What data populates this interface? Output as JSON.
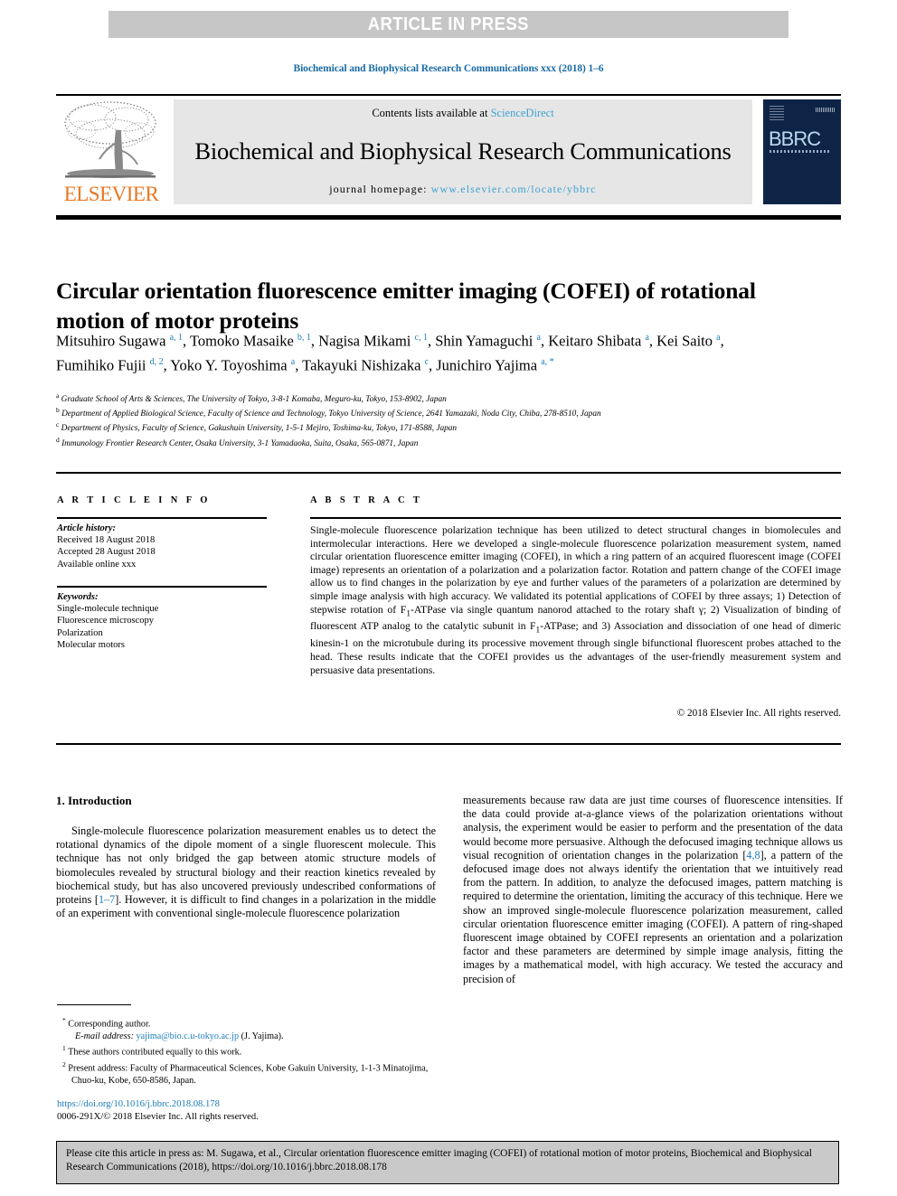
{
  "banner": {
    "text": "ARTICLE IN PRESS"
  },
  "running_head": "Biochemical and Biophysical Research Communications xxx (2018) 1–6",
  "masthead": {
    "contents_prefix": "Contents lists available at ",
    "contents_link": "ScienceDirect",
    "journal_title": "Biochemical and Biophysical Research Communications",
    "homepage_prefix": "journal homepage: ",
    "homepage_url": "www.elsevier.com/locate/ybbrc",
    "publisher_name": "ELSEVIER",
    "cover_title": "BBRC",
    "link_color": "#3fa2d1",
    "brand_color": "#e87722"
  },
  "article": {
    "title": "Circular orientation fluorescence emitter imaging (COFEI) of rotational motion of motor proteins",
    "authors_html": "Mitsuhiro Sugawa <sup>a, 1</sup>, Tomoko Masaike <sup>b, 1</sup>, Nagisa Mikami <sup>c, 1</sup>, Shin Yamaguchi <sup>a</sup>, Keitaro Shibata <sup>a</sup>, Kei Saito <sup>a</sup>, Fumihiko Fujii <sup>d, 2</sup>, Yoko Y. Toyoshima <sup>a</sup>, Takayuki Nishizaka <sup>c</sup>, Junichiro Yajima <sup>a, *</sup>",
    "affiliations": [
      {
        "label": "a",
        "text": "Graduate School of Arts & Sciences, The University of Tokyo, 3-8-1 Komaba, Meguro-ku, Tokyo, 153-8902, Japan"
      },
      {
        "label": "b",
        "text": "Department of Applied Biological Science, Faculty of Science and Technology, Tokyo University of Science, 2641 Yamazaki, Noda City, Chiba, 278-8510, Japan"
      },
      {
        "label": "c",
        "text": "Department of Physics, Faculty of Science, Gakushuin University, 1-5-1 Mejiro, Toshima-ku, Tokyo, 171-8588, Japan"
      },
      {
        "label": "d",
        "text": "Immunology Frontier Research Center, Osaka University, 3-1 Yamadaoka, Suita, Osaka, 565-0871, Japan"
      }
    ]
  },
  "article_info": {
    "heading": "A R T I C L E   I N F O",
    "history_label": "Article history:",
    "history": [
      "Received 18 August 2018",
      "Accepted 28 August 2018",
      "Available online xxx"
    ],
    "keywords_label": "Keywords:",
    "keywords": [
      "Single-molecule technique",
      "Fluorescence microscopy",
      "Polarization",
      "Molecular motors"
    ]
  },
  "abstract": {
    "heading": "A B S T R A C T",
    "body": "Single-molecule fluorescence polarization technique has been utilized to detect structural changes in biomolecules and intermolecular interactions. Here we developed a single-molecule fluorescence polarization measurement system, named circular orientation fluorescence emitter imaging (COFEI), in which a ring pattern of an acquired fluorescent image (COFEI image) represents an orientation of a polarization and a polarization factor. Rotation and pattern change of the COFEI image allow us to find changes in the polarization by eye and further values of the parameters of a polarization are determined by simple image analysis with high accuracy. We validated its potential applications of COFEI by three assays; 1) Detection of stepwise rotation of F1-ATPase via single quantum nanorod attached to the rotary shaft γ; 2) Visualization of binding of fluorescent ATP analog to the catalytic subunit in F1-ATPase; and 3) Association and dissociation of one head of dimeric kinesin-1 on the microtubule during its processive movement through single bifunctional fluorescent probes attached to the head. These results indicate that the COFEI provides us the advantages of the user-friendly measurement system and persuasive data presentations.",
    "copyright": "© 2018 Elsevier Inc. All rights reserved."
  },
  "body": {
    "section_number_title": "1.  Introduction",
    "left_paragraph": "Single-molecule fluorescence polarization measurement enables us to detect the rotational dynamics of the dipole moment of a single fluorescent molecule. This technique has not only bridged the gap between atomic structure models of biomolecules revealed by structural biology and their reaction kinetics revealed by biochemical study, but has also uncovered previously undescribed conformations of proteins [1–7]. However, it is difficult to find changes in a polarization in the middle of an experiment with conventional single-molecule fluorescence polarization",
    "left_ref": "1–7",
    "right_paragraph": "measurements because raw data are just time courses of fluorescence intensities. If the data could provide at-a-glance views of the polarization orientations without analysis, the experiment would be easier to perform and the presentation of the data would become more persuasive. Although the defocused imaging technique allows us visual recognition of orientation changes in the polarization [4,8], a pattern of the defocused image does not always identify the orientation that we intuitively read from the pattern. In addition, to analyze the defocused images, pattern matching is required to determine the orientation, limiting the accuracy of this technique. Here we show an improved single-molecule fluorescence polarization measurement, called circular orientation fluorescence emitter imaging (COFEI). A pattern of ring-shaped fluorescent image obtained by COFEI represents an orientation and a polarization factor and these parameters are determined by simple image analysis, fitting the images by a mathematical model, with high accuracy. We tested the accuracy and precision of",
    "right_ref": "4,8"
  },
  "footnotes": {
    "corresponding": "Corresponding author.",
    "email_label": "E-mail address:",
    "email": "yajima@bio.c.u-tokyo.ac.jp",
    "email_owner": "(J. Yajima).",
    "note1": "These authors contributed equally to this work.",
    "note2": "Present address: Faculty of Pharmaceutical Sciences, Kobe Gakuin University, 1-1-3 Minatojima, Chuo-ku, Kobe, 650-8586, Japan.",
    "doi": "https://doi.org/10.1016/j.bbrc.2018.08.178",
    "issn_line": "0006-291X/© 2018 Elsevier Inc. All rights reserved."
  },
  "cite_box": {
    "text": "Please cite this article in press as: M. Sugawa, et al., Circular orientation fluorescence emitter imaging (COFEI) of rotational motion of motor proteins, Biochemical and Biophysical Research Communications (2018), https://doi.org/10.1016/j.bbrc.2018.08.178"
  }
}
